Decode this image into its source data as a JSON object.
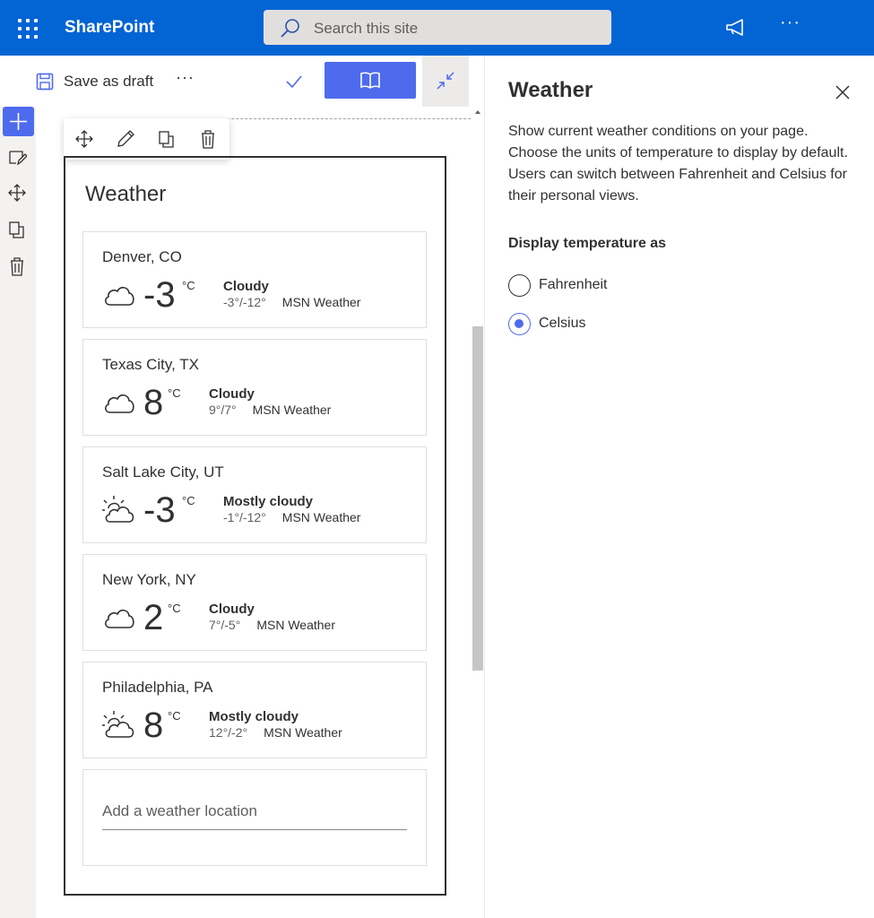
{
  "suite": {
    "brand": "SharePoint",
    "search_placeholder": "Search this site",
    "more_glyph": "···"
  },
  "command_bar": {
    "save_label": "Save as draft",
    "more_glyph": "···"
  },
  "webpart": {
    "title": "Weather",
    "locations": [
      {
        "city": "Denver, CO",
        "temp": "-3",
        "unit": "°C",
        "condition": "Cloudy",
        "range": "-3°/-12°",
        "source": "MSN Weather",
        "icon": "cloud-icon"
      },
      {
        "city": "Texas City, TX",
        "temp": "8",
        "unit": "°C",
        "condition": "Cloudy",
        "range": "9°/7°",
        "source": "MSN Weather",
        "icon": "cloud-icon"
      },
      {
        "city": "Salt Lake City, UT",
        "temp": "-3",
        "unit": "°C",
        "condition": "Mostly cloudy",
        "range": "-1°/-12°",
        "source": "MSN Weather",
        "icon": "mostly-cloudy-icon"
      },
      {
        "city": "New York, NY",
        "temp": "2",
        "unit": "°C",
        "condition": "Cloudy",
        "range": "7°/-5°",
        "source": "MSN Weather",
        "icon": "cloud-icon"
      },
      {
        "city": "Philadelphia, PA",
        "temp": "8",
        "unit": "°C",
        "condition": "Mostly cloudy",
        "range": "12°/-2°",
        "source": "MSN Weather",
        "icon": "mostly-cloudy-icon"
      }
    ],
    "add_placeholder": "Add a weather location"
  },
  "panel": {
    "title": "Weather",
    "description": "Show current weather conditions on your page. Choose the units of temperature to display by default. Users can switch between Fahrenheit and Celsius for their personal views.",
    "group_label": "Display temperature as",
    "options": [
      {
        "label": "Fahrenheit",
        "selected": false
      },
      {
        "label": "Celsius",
        "selected": true
      }
    ]
  },
  "colors": {
    "suite_bar": "#0364d4",
    "accent": "#4f6bed",
    "text": "#323130"
  }
}
